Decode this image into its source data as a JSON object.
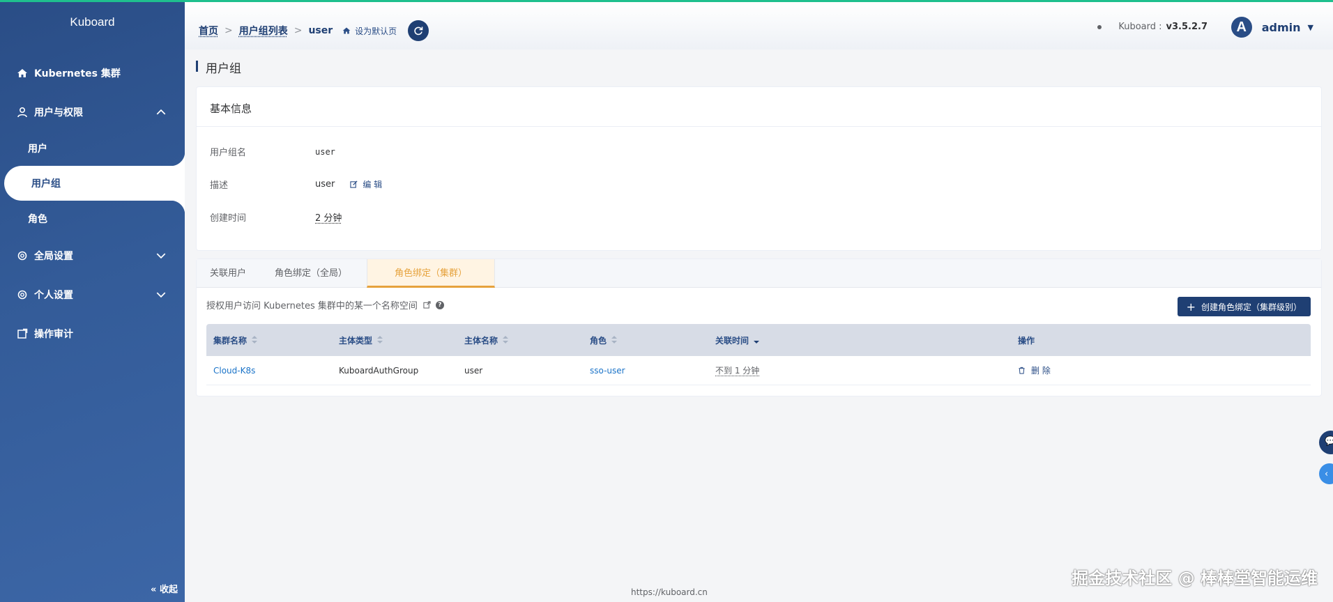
{
  "sidebar": {
    "brand": "Kuboard",
    "items": [
      {
        "label": "Kubernetes 集群"
      },
      {
        "label": "用户与权限"
      },
      {
        "label": "全局设置"
      },
      {
        "label": "个人设置"
      },
      {
        "label": "操作审计"
      }
    ],
    "sub_items": [
      {
        "label": "用户"
      },
      {
        "label": "用户组"
      },
      {
        "label": "角色"
      }
    ],
    "collapse": "收起"
  },
  "header": {
    "breadcrumb": [
      "首页",
      "用户组列表",
      "user"
    ],
    "set_default": "设为默认页",
    "version_label": "Kuboard :",
    "version": "v3.5.2.7",
    "avatar_letter": "A",
    "username": "admin"
  },
  "page": {
    "title": "用户组"
  },
  "basic_info": {
    "title": "基本信息",
    "name_label": "用户组名",
    "name_value": "user",
    "desc_label": "描述",
    "desc_value": "user",
    "edit_label": "编 辑",
    "created_label": "创建时间",
    "created_value": "2 分钟"
  },
  "tabs": {
    "items": [
      {
        "label": "关联用户"
      },
      {
        "label": "角色绑定（全局）"
      },
      {
        "label": "角色绑定（集群）"
      }
    ],
    "active": 2,
    "description": "授权用户访问 Kubernetes 集群中的某一个名称空间",
    "create_button": "创建角色绑定（集群级别）"
  },
  "table": {
    "headers": [
      "集群名称",
      "主体类型",
      "主体名称",
      "角色",
      "关联时间",
      "操作"
    ],
    "rows": [
      {
        "cluster": "Cloud-K8s",
        "subject_type": "KuboardAuthGroup",
        "subject_name": "user",
        "role": "sso-user",
        "time": "不到 1 分钟",
        "action": "删 除"
      }
    ]
  },
  "footer": "https://kuboard.cn",
  "watermark": "掘金技术社区 @ 棒棒堂智能运维"
}
